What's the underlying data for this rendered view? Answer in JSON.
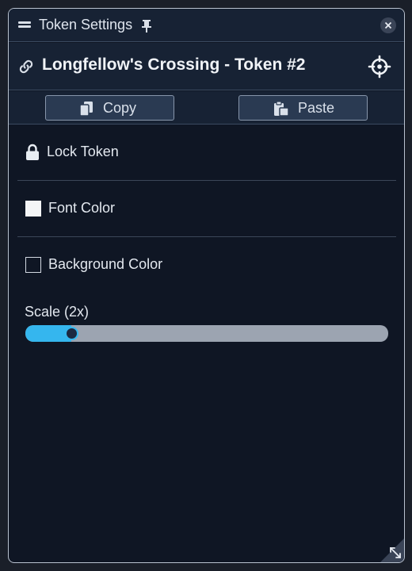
{
  "window": {
    "title": "Token Settings"
  },
  "header": {
    "token_name": "Longfellow's Crossing - Token #2"
  },
  "actions": {
    "copy_label": "Copy",
    "paste_label": "Paste"
  },
  "settings": {
    "lock_label": "Lock Token",
    "font_color_label": "Font Color",
    "font_color": "#f4f5f7",
    "background_color_label": "Background Color",
    "scale_label": "Scale (2x)",
    "scale_fraction": 0.127
  },
  "icons": {
    "drag": "drag-handle-icon",
    "pin": "pin-icon",
    "close": "close-icon",
    "link": "link-icon",
    "target": "crosshair-icon",
    "copy": "copy-icon",
    "paste": "clipboard-icon",
    "lock": "lock-icon",
    "resize": "resize-icon"
  },
  "colors": {
    "accent": "#35b6ee",
    "panel_bg": "#0f1624",
    "header_bg": "#172234",
    "button_bg": "#2a3a52"
  }
}
